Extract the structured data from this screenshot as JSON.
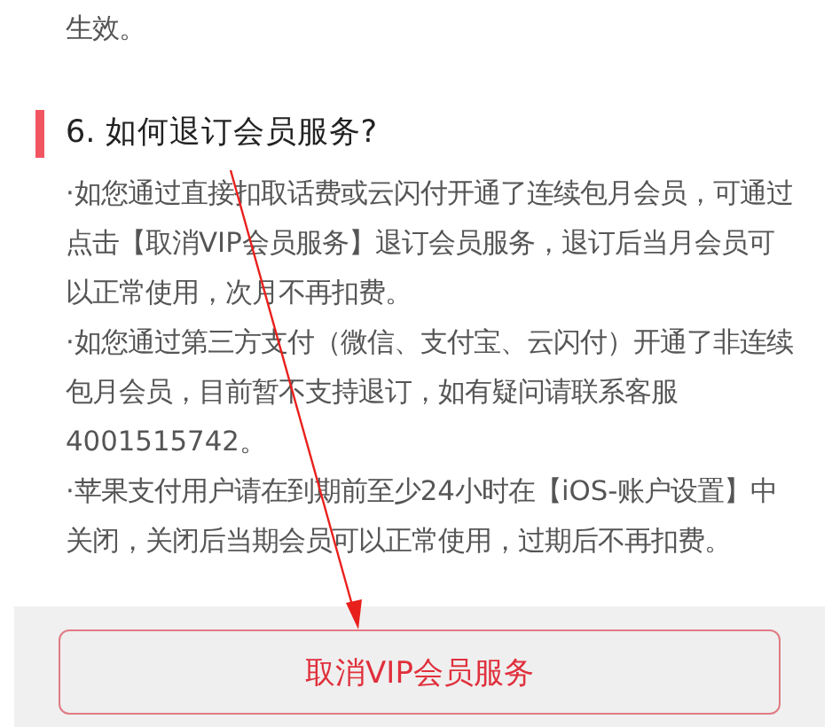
{
  "intro_tail": "生效。",
  "section": {
    "title": "6. 如何退订会员服务?",
    "paragraphs": [
      "·如您通过直接扣取话费或云闪付开通了连续包月会员，可通过点击【取消VIP会员服务】退订会员服务，退订后当月会员可以正常使用，次月不再扣费。",
      "·如您通过第三方支付（微信、支付宝、云闪付）开通了非连续包月会员，目前暂不支持退订，如有疑问请联系客服4001515742。",
      "·苹果支付用户请在到期前至少24小时在【iOS-账户设置】中关闭，关闭后当期会员可以正常使用，过期后不再扣费。"
    ]
  },
  "cancel_button": {
    "label": "取消VIP会员服务"
  }
}
